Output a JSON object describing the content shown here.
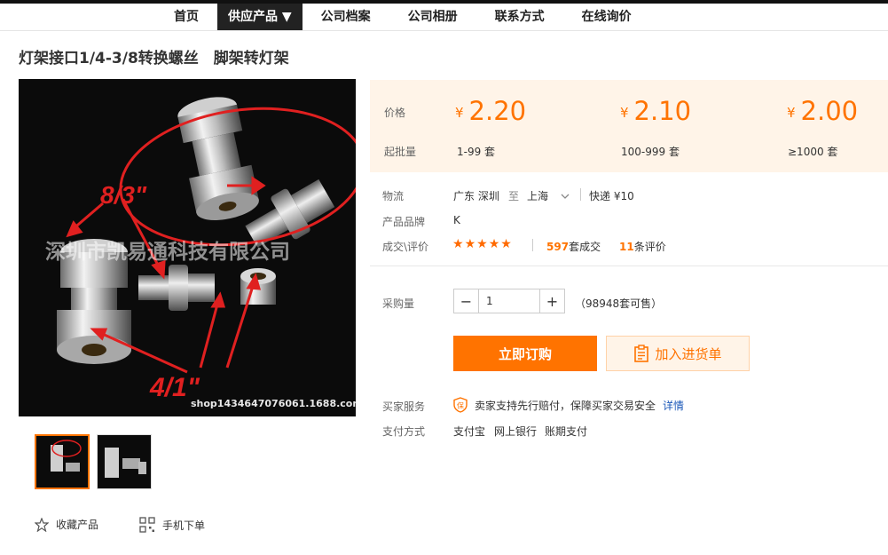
{
  "nav": {
    "items": [
      {
        "label": "首页"
      },
      {
        "label": "供应产品 ▼"
      },
      {
        "label": "公司档案"
      },
      {
        "label": "公司相册"
      },
      {
        "label": "联系方式"
      },
      {
        "label": "在线询价"
      }
    ],
    "active_index": 1
  },
  "product": {
    "title": "灯架接口1/4-3/8转换螺丝　脚架转灯架",
    "image": {
      "label_top": "8/3\"",
      "label_bottom": "4/1\"",
      "watermark": "深圳市凯易通科技有限公司",
      "shop_url": "shop1434647076061.1688.com"
    }
  },
  "actions": {
    "favorite_label": "收藏产品",
    "mobile_label": "手机下单"
  },
  "pricing": {
    "price_label": "价格",
    "moq_label": "起批量",
    "currency": "¥",
    "tiers": [
      {
        "price": "2.20",
        "range": "1-99 套"
      },
      {
        "price": "2.10",
        "range": "100-999 套"
      },
      {
        "price": "2.00",
        "range": "≥1000 套"
      }
    ]
  },
  "logistics": {
    "label": "物流",
    "from": "广东 深圳",
    "to_word": "至",
    "dest": "上海",
    "shipping": "快递 ¥10"
  },
  "brand": {
    "label": "产品品牌",
    "value": "K"
  },
  "deals": {
    "label": "成交\\评价",
    "rating": 5,
    "sold_count": "597",
    "sold_suffix": "套成交",
    "review_count": "11",
    "review_suffix": "条评价"
  },
  "purchase": {
    "qty_label": "采购量",
    "qty_value": "1",
    "stock_text": "（98948套可售）",
    "buy_label": "立即订购",
    "cart_label": "加入进货单"
  },
  "service": {
    "label": "买家服务",
    "text": "卖家支持先行赔付，保障买家交易安全",
    "detail_link": "详情"
  },
  "payment": {
    "label": "支付方式",
    "methods": [
      "支付宝",
      "网上银行",
      "账期支付"
    ]
  },
  "colors": {
    "accent": "#ff7300",
    "price_bg": "#fff4e8",
    "nav_active_bg": "#222222",
    "link": "#1b58b8"
  }
}
